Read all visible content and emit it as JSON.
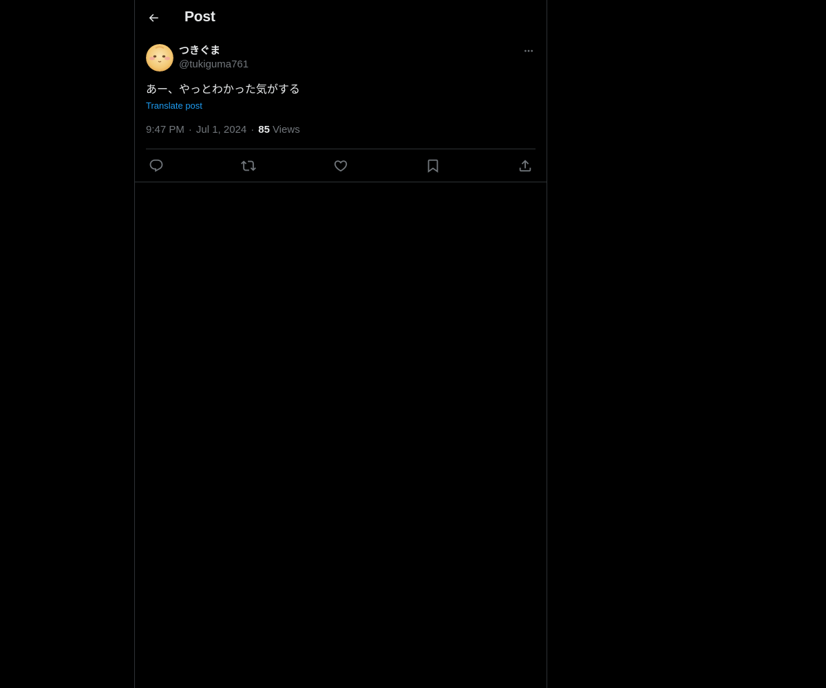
{
  "header": {
    "title": "Post"
  },
  "post": {
    "author": {
      "display_name": "つきぐま",
      "handle": "@tukiguma761"
    },
    "text": "あー、やっとわかった気がする",
    "translate_label": "Translate post",
    "time": "9:47 PM",
    "date": "Jul 1, 2024",
    "views_count": "85",
    "views_label": "Views",
    "separator": "·"
  },
  "icons": {
    "back": "arrow-left-icon",
    "more": "more-horizontal-icon",
    "reply": "reply-icon",
    "repost": "repost-icon",
    "like": "heart-icon",
    "bookmark": "bookmark-icon",
    "share": "share-icon"
  },
  "colors": {
    "background": "#000000",
    "text_primary": "#e7e9ea",
    "text_secondary": "#71767b",
    "link": "#1d9bf0",
    "border": "#2f3336"
  }
}
